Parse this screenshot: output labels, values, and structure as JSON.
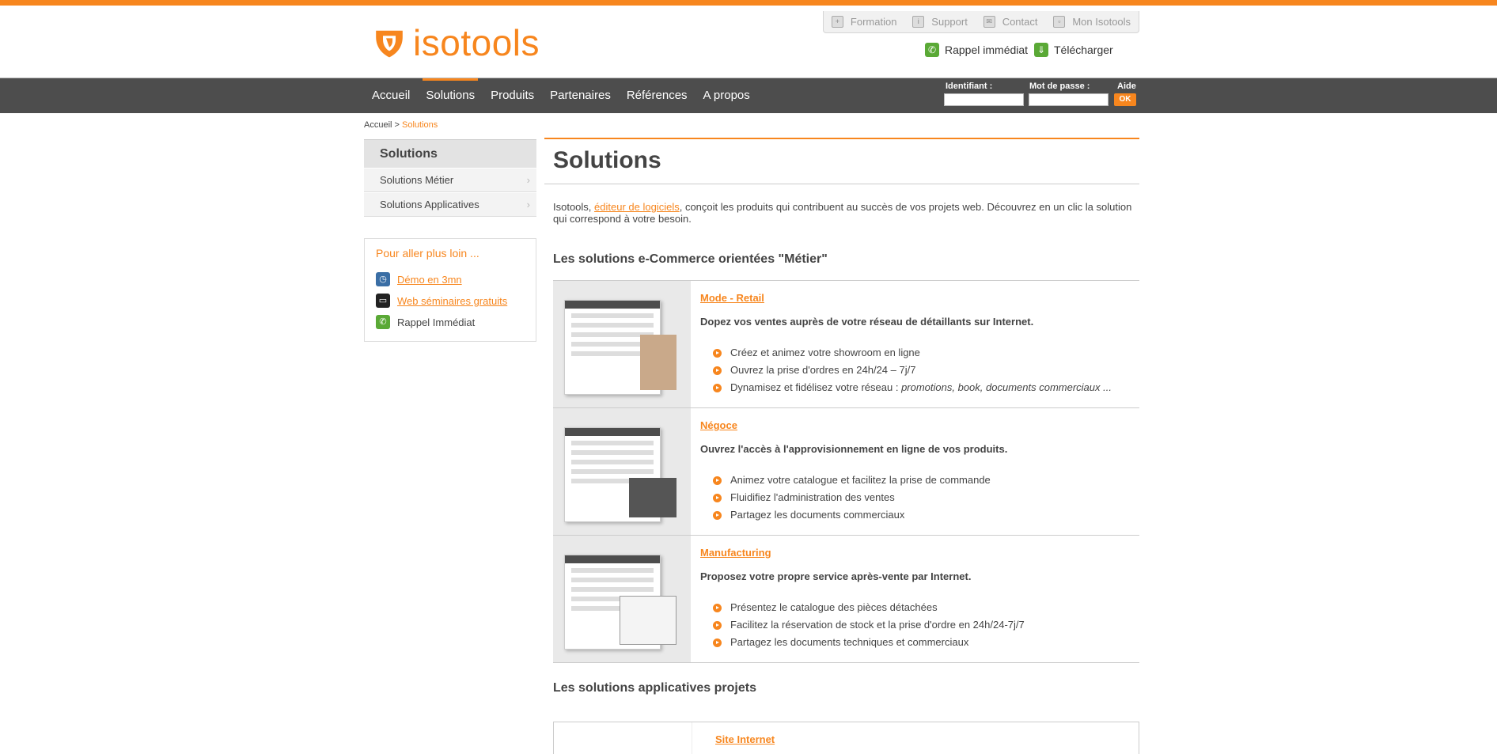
{
  "brand": {
    "name": "isotools",
    "color": "#f7861e"
  },
  "toplinks": [
    {
      "label": "Formation",
      "icon": "formation-icon"
    },
    {
      "label": "Support",
      "icon": "support-icon"
    },
    {
      "label": "Contact",
      "icon": "contact-icon"
    },
    {
      "label": "Mon Isotools",
      "icon": "account-icon"
    }
  ],
  "quick": {
    "callback": "Rappel immédiat",
    "download": "Télécharger"
  },
  "nav": [
    "Accueil",
    "Solutions",
    "Produits",
    "Partenaires",
    "Références",
    "A propos"
  ],
  "nav_active": "Solutions",
  "login": {
    "id_label": "Identifiant :",
    "pw_label": "Mot de passe :",
    "help": "Aide",
    "ok": "OK",
    "id_value": "",
    "pw_value": ""
  },
  "breadcrumb": {
    "home": "Accueil",
    "sep": " > ",
    "current": "Solutions"
  },
  "sidebar": {
    "title": "Solutions",
    "items": [
      "Solutions Métier",
      "Solutions Applicatives"
    ],
    "more_title": "Pour aller plus loin ...",
    "more_items": [
      "Démo en 3mn",
      "Web séminaires gratuits",
      "Rappel Immédiat"
    ]
  },
  "main": {
    "title": "Solutions",
    "intro_prefix": "Isotools, ",
    "intro_link": "éditeur de logiciels",
    "intro_rest": ", conçoit les produits qui contribuent au succès de vos projets web. Découvrez en un clic la solution qui correspond à votre besoin.",
    "section1": "Les solutions e-Commerce orientées \"Métier\"",
    "solutions": [
      {
        "name": "Mode - Retail",
        "desc": "Dopez vos ventes auprès de votre réseau de détaillants sur Internet.",
        "bullets": [
          "Créez et animez votre showroom en ligne",
          "Ouvrez la prise d'ordres en 24h/24 – 7j/7",
          "Dynamisez et fidélisez votre réseau : "
        ],
        "bullet_italic": "promotions, book, documents commerciaux ..."
      },
      {
        "name": "Négoce",
        "desc": "Ouvrez l'accès à l'approvisionnement en ligne de vos produits.",
        "bullets": [
          "Animez votre catalogue et facilitez la prise de commande",
          "Fluidifiez l'administration des ventes",
          "Partagez les documents commerciaux"
        ]
      },
      {
        "name": "Manufacturing",
        "desc": "Proposez votre propre service après-vente par Internet.",
        "bullets": [
          "Présentez le catalogue des pièces détachées",
          "Facilitez la réservation  de stock et la prise d'ordre en 24h/24-7j/7",
          "Partagez les documents techniques et commerciaux"
        ]
      }
    ],
    "section2": "Les solutions applicatives projets",
    "next_item": "Site Internet"
  }
}
